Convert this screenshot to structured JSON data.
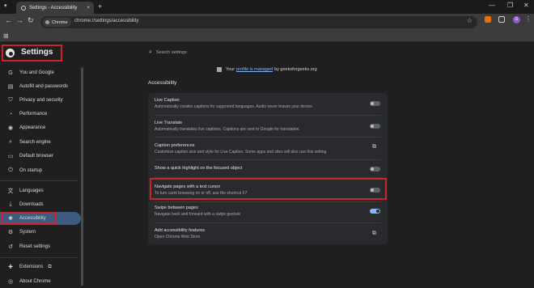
{
  "browser": {
    "tab_title": "Settings - Accessibility",
    "tab_close": "×",
    "new_tab": "+",
    "tab_menu": "▾",
    "win_min": "—",
    "win_max": "❐",
    "win_close": "✕",
    "back": "←",
    "forward": "→",
    "reload": "↻",
    "chip_label": "Chrome",
    "url": "chrome://settings/accessibility",
    "profile_initial": "G",
    "apps_icon": "⊞"
  },
  "header": {
    "title": "Settings",
    "search_placeholder": "Search settings"
  },
  "sidebar": {
    "items": [
      {
        "label": "You and Google",
        "icon": "google-icon",
        "glyph": "G"
      },
      {
        "label": "Autofill and passwords",
        "icon": "autofill-icon",
        "glyph": "▤"
      },
      {
        "label": "Privacy and security",
        "icon": "shield-icon",
        "glyph": "⛉"
      },
      {
        "label": "Performance",
        "icon": "performance-icon",
        "glyph": "◔"
      },
      {
        "label": "Appearance",
        "icon": "palette-icon",
        "glyph": "◉"
      },
      {
        "label": "Search engine",
        "icon": "search-icon",
        "glyph": "⌕"
      },
      {
        "label": "Default browser",
        "icon": "browser-icon",
        "glyph": "▭"
      },
      {
        "label": "On startup",
        "icon": "power-icon",
        "glyph": "⏻"
      },
      {
        "label": "Languages",
        "icon": "languages-icon",
        "glyph": "文"
      },
      {
        "label": "Downloads",
        "icon": "download-icon",
        "glyph": "⤓"
      },
      {
        "label": "Accessibility",
        "icon": "accessibility-icon",
        "glyph": "✱"
      },
      {
        "label": "System",
        "icon": "wrench-icon",
        "glyph": "⚙"
      },
      {
        "label": "Reset settings",
        "icon": "reset-icon",
        "glyph": "↺"
      },
      {
        "label": "Extensions",
        "icon": "extensions-icon",
        "glyph": "✚"
      },
      {
        "label": "About Chrome",
        "icon": "chrome-icon",
        "glyph": "◎"
      }
    ],
    "active": "Accessibility"
  },
  "main": {
    "managed_prefix": "Your",
    "managed_link": "profile is managed",
    "managed_suffix": "by geeksforgeeks.org",
    "section_title": "Accessibility",
    "rows": [
      {
        "title": "Live Caption",
        "subtitle": "Automatically creates captions for supported languages. Audio never leaves your device.",
        "control": "toggle",
        "on": false
      },
      {
        "title": "Live Translate",
        "subtitle": "Automatically translates live captions. Captions are sent to Google for translation.",
        "control": "toggle",
        "on": false
      },
      {
        "title": "Caption preferences",
        "subtitle": "Customize caption size and style for Live Caption. Some apps and sites will also use this setting.",
        "control": "external-link"
      },
      {
        "title": "Show a quick highlight on the focused object",
        "subtitle": "",
        "control": "toggle",
        "on": false
      },
      {
        "title": "Navigate pages with a text cursor",
        "subtitle": "To turn caret browsing on or off, use the shortcut F7",
        "control": "toggle",
        "on": false
      },
      {
        "title": "Swipe between pages",
        "subtitle": "Navigate back and forward with a swipe gesture",
        "control": "toggle",
        "on": true
      },
      {
        "title": "Add accessibility features",
        "subtitle": "Open Chrome Web Store",
        "control": "external-link"
      }
    ],
    "external_glyph": "⧉"
  },
  "colors": {
    "accent": "#8ab4f8",
    "highlight": "#d0202a",
    "active_nav": "#3d5a80"
  }
}
